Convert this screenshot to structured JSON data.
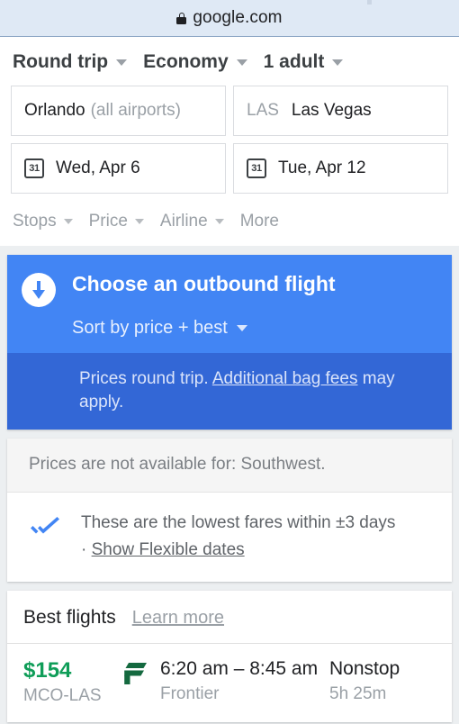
{
  "browser": {
    "lock_icon": "lock-icon",
    "url": "google.com"
  },
  "search": {
    "trip_options": [
      {
        "label": "Round trip",
        "icon": "chevron-down-icon"
      },
      {
        "label": "Economy",
        "icon": "chevron-down-icon"
      },
      {
        "label": "1 adult",
        "icon": "chevron-down-icon"
      }
    ],
    "origin": {
      "primary": "Orlando",
      "secondary": "(all airports)"
    },
    "destination": {
      "code": "LAS",
      "primary": "Las Vegas"
    },
    "depart_date": {
      "icon": "calendar-icon",
      "icon_label": "31",
      "label": "Wed, Apr 6"
    },
    "return_date": {
      "icon": "calendar-icon",
      "icon_label": "31",
      "label": "Tue, Apr 12"
    },
    "filters": [
      {
        "label": "Stops",
        "has_caret": true
      },
      {
        "label": "Price",
        "has_caret": true
      },
      {
        "label": "Airline",
        "has_caret": true
      },
      {
        "label": "More",
        "has_caret": false
      }
    ]
  },
  "banner": {
    "icon": "download-arrow-icon",
    "title": "Choose an outbound flight",
    "sort_label": "Sort by price + best",
    "sort_icon": "chevron-down-icon",
    "note_prefix": "Prices round trip. ",
    "note_link": "Additional bag fees",
    "note_suffix": " may apply.",
    "bg_color": "#4285f4",
    "subbanner_bg_color": "#3367d6"
  },
  "notice": {
    "text": "Prices are not available for: Southwest."
  },
  "fares": {
    "icon": "double-check-icon",
    "icon_color": "#4285f4",
    "line1": "These are the lowest fares within ±3 days",
    "bullet": "· ",
    "link": "Show Flexible dates"
  },
  "best_flights": {
    "title": "Best flights",
    "learn_more": "Learn more",
    "rows": [
      {
        "price": "$154",
        "price_color": "#0f9d58",
        "route": "MCO-LAS",
        "airline_logo": "frontier-logo-icon",
        "times": "6:20 am – 8:45 am",
        "airline": "Frontier",
        "stops": "Nonstop",
        "duration": "5h 25m"
      }
    ]
  }
}
